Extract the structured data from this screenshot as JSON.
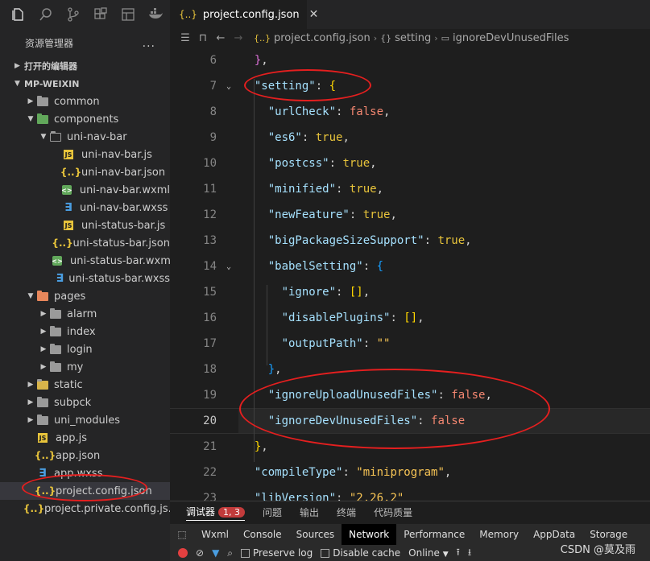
{
  "activity_bar": {
    "icons": [
      "files-icon",
      "search-icon",
      "source-control-icon",
      "extensions-icon",
      "layout-icon",
      "docker-icon"
    ]
  },
  "sidebar": {
    "title": "资源管理器",
    "more": "...",
    "sections": [
      {
        "label": "打开的编辑器",
        "expanded": false
      },
      {
        "label": "MP-WEIXIN",
        "expanded": true
      }
    ],
    "tree": [
      {
        "label": "common",
        "type": "folder",
        "depth": 0,
        "expanded": false
      },
      {
        "label": "components",
        "type": "folder-green",
        "depth": 0,
        "expanded": true
      },
      {
        "label": "uni-nav-bar",
        "type": "folder-open",
        "depth": 1,
        "expanded": true
      },
      {
        "label": "uni-nav-bar.js",
        "type": "js",
        "depth": 2
      },
      {
        "label": "uni-nav-bar.json",
        "type": "json",
        "depth": 2
      },
      {
        "label": "uni-nav-bar.wxml",
        "type": "wxml",
        "depth": 2
      },
      {
        "label": "uni-nav-bar.wxss",
        "type": "wxss",
        "depth": 2
      },
      {
        "label": "uni-status-bar.js",
        "type": "js",
        "depth": 2
      },
      {
        "label": "uni-status-bar.json",
        "type": "json",
        "depth": 2
      },
      {
        "label": "uni-status-bar.wxml",
        "type": "wxml",
        "depth": 2
      },
      {
        "label": "uni-status-bar.wxss",
        "type": "wxss",
        "depth": 2
      },
      {
        "label": "pages",
        "type": "folder-orange",
        "depth": 0,
        "expanded": true
      },
      {
        "label": "alarm",
        "type": "folder",
        "depth": 1,
        "expanded": false
      },
      {
        "label": "index",
        "type": "folder",
        "depth": 1,
        "expanded": false
      },
      {
        "label": "login",
        "type": "folder",
        "depth": 1,
        "expanded": false
      },
      {
        "label": "my",
        "type": "folder",
        "depth": 1,
        "expanded": false
      },
      {
        "label": "static",
        "type": "folder-yellow",
        "depth": 0,
        "expanded": false
      },
      {
        "label": "subpck",
        "type": "folder",
        "depth": 0,
        "expanded": false
      },
      {
        "label": "uni_modules",
        "type": "folder",
        "depth": 0,
        "expanded": false
      },
      {
        "label": "app.js",
        "type": "js",
        "depth": 0
      },
      {
        "label": "app.json",
        "type": "json",
        "depth": 0
      },
      {
        "label": "app.wxss",
        "type": "wxss",
        "depth": 0
      },
      {
        "label": "project.config.json",
        "type": "json",
        "depth": 0,
        "selected": true
      },
      {
        "label": "project.private.config.js...",
        "type": "json",
        "depth": 0
      }
    ]
  },
  "tab": {
    "icon": "{..}",
    "label": "project.config.json",
    "close": "✕"
  },
  "breadcrumb": {
    "file": "project.config.json",
    "obj_icon": "{}",
    "obj": "setting",
    "prop": "ignoreDevUnusedFiles"
  },
  "code": [
    {
      "n": "6",
      "fold": false,
      "parts": [
        [
          "brace",
          "  }"
        ],
        [
          "punc",
          ","
        ]
      ]
    },
    {
      "n": "7",
      "fold": true,
      "parts": [
        [
          "key",
          "  \"setting\""
        ],
        [
          "punc",
          ": "
        ],
        [
          "brace2",
          "{"
        ]
      ]
    },
    {
      "n": "8",
      "fold": false,
      "parts": [
        [
          "key",
          "    \"urlCheck\""
        ],
        [
          "punc",
          ": "
        ],
        [
          "false",
          "false"
        ],
        [
          "punc",
          ","
        ]
      ]
    },
    {
      "n": "9",
      "fold": false,
      "parts": [
        [
          "key",
          "    \"es6\""
        ],
        [
          "punc",
          ": "
        ],
        [
          "true",
          "true"
        ],
        [
          "punc",
          ","
        ]
      ]
    },
    {
      "n": "10",
      "fold": false,
      "parts": [
        [
          "key",
          "    \"postcss\""
        ],
        [
          "punc",
          ": "
        ],
        [
          "true",
          "true"
        ],
        [
          "punc",
          ","
        ]
      ]
    },
    {
      "n": "11",
      "fold": false,
      "parts": [
        [
          "key",
          "    \"minified\""
        ],
        [
          "punc",
          ": "
        ],
        [
          "true",
          "true"
        ],
        [
          "punc",
          ","
        ]
      ]
    },
    {
      "n": "12",
      "fold": false,
      "parts": [
        [
          "key",
          "    \"newFeature\""
        ],
        [
          "punc",
          ": "
        ],
        [
          "true",
          "true"
        ],
        [
          "punc",
          ","
        ]
      ]
    },
    {
      "n": "13",
      "fold": false,
      "parts": [
        [
          "key",
          "    \"bigPackageSizeSupport\""
        ],
        [
          "punc",
          ": "
        ],
        [
          "true",
          "true"
        ],
        [
          "punc",
          ","
        ]
      ]
    },
    {
      "n": "14",
      "fold": true,
      "parts": [
        [
          "key",
          "    \"babelSetting\""
        ],
        [
          "punc",
          ": "
        ],
        [
          "brace3",
          "{"
        ]
      ]
    },
    {
      "n": "15",
      "fold": false,
      "parts": [
        [
          "key",
          "      \"ignore\""
        ],
        [
          "punc",
          ": "
        ],
        [
          "brace2",
          "[]"
        ],
        [
          "punc",
          ","
        ]
      ]
    },
    {
      "n": "16",
      "fold": false,
      "parts": [
        [
          "key",
          "      \"disablePlugins\""
        ],
        [
          "punc",
          ": "
        ],
        [
          "brace2",
          "[]"
        ],
        [
          "punc",
          ","
        ]
      ]
    },
    {
      "n": "17",
      "fold": false,
      "parts": [
        [
          "key",
          "      \"outputPath\""
        ],
        [
          "punc",
          ": "
        ],
        [
          "str",
          "\"\""
        ]
      ]
    },
    {
      "n": "18",
      "fold": false,
      "parts": [
        [
          "brace3",
          "    }"
        ],
        [
          "punc",
          ","
        ]
      ]
    },
    {
      "n": "19",
      "fold": false,
      "parts": [
        [
          "key",
          "    \"ignoreUploadUnusedFiles\""
        ],
        [
          "punc",
          ": "
        ],
        [
          "false",
          "false"
        ],
        [
          "punc",
          ","
        ]
      ]
    },
    {
      "n": "20",
      "fold": false,
      "active": true,
      "parts": [
        [
          "key",
          "    \"ignoreDevUnusedFiles\""
        ],
        [
          "punc",
          ": "
        ],
        [
          "false",
          "false"
        ]
      ]
    },
    {
      "n": "21",
      "fold": false,
      "parts": [
        [
          "brace2",
          "  }"
        ],
        [
          "punc",
          ","
        ]
      ]
    },
    {
      "n": "22",
      "fold": false,
      "parts": [
        [
          "key",
          "  \"compileType\""
        ],
        [
          "punc",
          ": "
        ],
        [
          "str",
          "\"miniprogram\""
        ],
        [
          "punc",
          ","
        ]
      ]
    },
    {
      "n": "23",
      "fold": false,
      "parts": [
        [
          "key",
          "  \"libVersion\""
        ],
        [
          "punc",
          ": "
        ],
        [
          "str",
          "\"2.26.2\""
        ]
      ]
    }
  ],
  "debug_tabs": [
    {
      "label": "调试器",
      "active": true,
      "badge": "1, 3"
    },
    {
      "label": "问题",
      "active": false
    },
    {
      "label": "输出",
      "active": false
    },
    {
      "label": "终端",
      "active": false
    },
    {
      "label": "代码质量",
      "active": false
    }
  ],
  "devtools_tabs": [
    {
      "label": "Wxml",
      "active": false
    },
    {
      "label": "Console",
      "active": false
    },
    {
      "label": "Sources",
      "active": false
    },
    {
      "label": "Network",
      "active": true
    },
    {
      "label": "Performance",
      "active": false
    },
    {
      "label": "Memory",
      "active": false
    },
    {
      "label": "AppData",
      "active": false
    },
    {
      "label": "Storage",
      "active": false
    }
  ],
  "devtools_toolbar": {
    "preserve_log": "Preserve log",
    "disable_cache": "Disable cache",
    "throttle": "Online"
  },
  "watermark": "CSDN @莫及雨",
  "colors": {
    "annotation": "#e51f1f",
    "editor_bg": "#1e1e1e",
    "sidebar_bg": "#252526"
  }
}
